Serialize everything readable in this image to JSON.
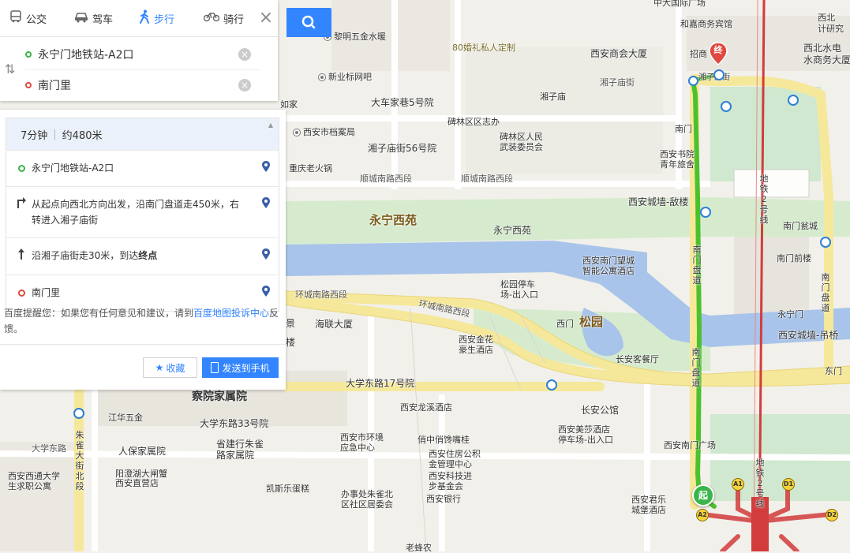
{
  "modes": [
    {
      "label": "公交",
      "icon": "bus-icon"
    },
    {
      "label": "驾车",
      "icon": "car-icon"
    },
    {
      "label": "步行",
      "icon": "walk-icon",
      "active": true
    },
    {
      "label": "骑行",
      "icon": "bike-icon"
    }
  ],
  "search": {
    "start": "永宁门地铁站-A2口",
    "end": "南门里"
  },
  "summary": {
    "time": "7分钟",
    "distance": "约480米"
  },
  "steps": [
    {
      "type": "start",
      "text": "永宁门地铁站-A2口"
    },
    {
      "type": "turn-right",
      "text": "从起点向西北方向出发，沿南门盘道走450米，右转进入湘子庙街"
    },
    {
      "type": "straight",
      "text_prefix": "沿湘子庙街走30米，到达",
      "text_bold": "终点"
    },
    {
      "type": "end",
      "text": "南门里"
    }
  ],
  "tip": {
    "prefix": "百度提醒您：如果您有任何意见和建议，请到",
    "link": "百度地图投诉中心",
    "suffix": "反馈。"
  },
  "actions": {
    "favorite": "收藏",
    "send": "发送到手机"
  },
  "markers": {
    "start": "起",
    "end": "终"
  },
  "colors": {
    "accent": "#3385ff",
    "route": "#4cc12e",
    "metro": "#d23c3c",
    "start": "#3ab54a",
    "end": "#e0493f"
  },
  "map_labels": [
    {
      "id": "zhongda",
      "text": "中大国际广场"
    },
    {
      "id": "hehao",
      "text": "和嘉商务宾馆"
    },
    {
      "id": "xibei-top",
      "text": "西北"
    },
    {
      "id": "jisuan",
      "text": "计研究"
    },
    {
      "id": "liming",
      "text": "黎明五金水暖"
    },
    {
      "id": "hunli",
      "text": "80婚礼私人定制"
    },
    {
      "id": "shanghui",
      "text": "西安商会大厦"
    },
    {
      "id": "zhaoshang",
      "text": "招商"
    },
    {
      "id": "xibeishuidian",
      "text": "西北水电"
    },
    {
      "id": "shuishangwu",
      "text": "水商务大厦"
    },
    {
      "id": "xinwang",
      "text": "新业标网吧"
    },
    {
      "id": "xiangzimiaojie-top",
      "text": "湘子庙街"
    },
    {
      "id": "xiangzimiaojie-2",
      "text": "湘子庙街"
    },
    {
      "id": "ruke",
      "text": "如家"
    },
    {
      "id": "dache5",
      "text": "大车家巷5号院"
    },
    {
      "id": "xiangzimiao",
      "text": "湘子庙"
    },
    {
      "id": "beilinzhi",
      "text": "碑林区区志办"
    },
    {
      "id": "danganju",
      "text": "西安市档案局"
    },
    {
      "id": "renmin",
      "text": "碑林区人民"
    },
    {
      "id": "wuzhuang",
      "text": "武装委员会"
    },
    {
      "id": "nanmen-1",
      "text": "南门"
    },
    {
      "id": "xiangzi56",
      "text": "湘子庙街56号院"
    },
    {
      "id": "shuyuan",
      "text": "西安书院"
    },
    {
      "id": "qingnian",
      "text": "青年旅舍"
    },
    {
      "id": "chongqing",
      "text": "重庆老火锅"
    },
    {
      "id": "shuncheng-1",
      "text": "顺城南路西段"
    },
    {
      "id": "shuncheng-2",
      "text": "顺城南路西段"
    },
    {
      "id": "ditie2",
      "text": "地铁2号线"
    },
    {
      "id": "dilou",
      "text": "西安城墙-敌楼"
    },
    {
      "id": "yongningxiyuan-big",
      "text": "永宁西苑"
    },
    {
      "id": "yongningxiyuan",
      "text": "永宁西苑"
    },
    {
      "id": "nanmenweng",
      "text": "南门瓮城"
    },
    {
      "id": "nanmenpandao-1",
      "text": "南门盘道"
    },
    {
      "id": "nanmenqianlou",
      "text": "南门前楼"
    },
    {
      "id": "wangcheng",
      "text": "西安南门望城"
    },
    {
      "id": "zhinenggongyu",
      "text": "智能公寓酒店"
    },
    {
      "id": "huancheng-1",
      "text": "环城南路西段"
    },
    {
      "id": "songyuanpark",
      "text": "松园停车"
    },
    {
      "id": "songyuanpark2",
      "text": "场-出入口"
    },
    {
      "id": "huancheng-2",
      "text": "环城南路西段"
    },
    {
      "id": "nanmen-right",
      "text": "南门盘道"
    },
    {
      "id": "yongningmen",
      "text": "永宁门"
    },
    {
      "id": "jing",
      "text": "景"
    },
    {
      "id": "haiLian",
      "text": "海联大厦"
    },
    {
      "id": "ximen",
      "text": "西门"
    },
    {
      "id": "songyuan",
      "text": "松园"
    },
    {
      "id": "diaoqiao",
      "text": "西安城墙-吊桥"
    },
    {
      "id": "jinhua",
      "text": "西安金花"
    },
    {
      "id": "haoshenghotel",
      "text": "豪生酒店"
    },
    {
      "id": "changan-restaurant",
      "text": "长安客餐厅"
    },
    {
      "id": "dongmen",
      "text": "东门"
    },
    {
      "id": "mou",
      "text": "楼"
    },
    {
      "id": "nanmenpandao-2",
      "text": "南门盘道"
    },
    {
      "id": "daxue17",
      "text": "大学东路17号院"
    },
    {
      "id": "chayuan",
      "text": "察院家属院"
    },
    {
      "id": "longxi",
      "text": "西安龙溪酒店"
    },
    {
      "id": "changangongguan",
      "text": "长安公馆"
    },
    {
      "id": "jianghua",
      "text": "江华五金"
    },
    {
      "id": "daxue33",
      "text": "大学东路33号院"
    },
    {
      "id": "huanjing",
      "text": "西安市环境"
    },
    {
      "id": "yingji",
      "text": "应急中心"
    },
    {
      "id": "qiaochan",
      "text": "俏中俏馋嘴桂"
    },
    {
      "id": "meishasha",
      "text": "西安美莎酒店"
    },
    {
      "id": "tingchechang",
      "text": "停车场-出入口"
    },
    {
      "id": "nanmenguangchang",
      "text": "西安南门广场"
    },
    {
      "id": "daxuedonglu",
      "text": "大学东路"
    },
    {
      "id": "renbao",
      "text": "人保家属院"
    },
    {
      "id": "shengjianhang",
      "text": "省建行朱雀"
    },
    {
      "id": "lujiashu",
      "text": "路家属院"
    },
    {
      "id": "zhufang",
      "text": "西安住房公积"
    },
    {
      "id": "jinguanli",
      "text": "金管理中心"
    },
    {
      "id": "zhuquedajie",
      "text": "朱雀大街北段"
    },
    {
      "id": "xibeidaxue",
      "text": "西安西通大学"
    },
    {
      "id": "shengqiu",
      "text": "生求职公寓"
    },
    {
      "id": "yangcheng",
      "text": "阳澄湖大闸蟹"
    },
    {
      "id": "zhiying",
      "text": "西安直营店"
    },
    {
      "id": "keji",
      "text": "西安科技进"
    },
    {
      "id": "bujinhui",
      "text": "步基金会"
    },
    {
      "id": "ditie2b",
      "text": "地铁2号线"
    },
    {
      "id": "kaisi",
      "text": "凯斯乐蛋糕"
    },
    {
      "id": "banshichu",
      "text": "办事处朱雀北"
    },
    {
      "id": "shequ",
      "text": "区社区居委会"
    },
    {
      "id": "xianbank",
      "text": "西安银行"
    },
    {
      "id": "junle",
      "text": "西安君乐"
    },
    {
      "id": "chengbao",
      "text": "城堡酒店"
    },
    {
      "id": "laofengnong",
      "text": "老蜂农"
    }
  ],
  "metro_exits": [
    "A1",
    "A2",
    "D1",
    "D2"
  ]
}
